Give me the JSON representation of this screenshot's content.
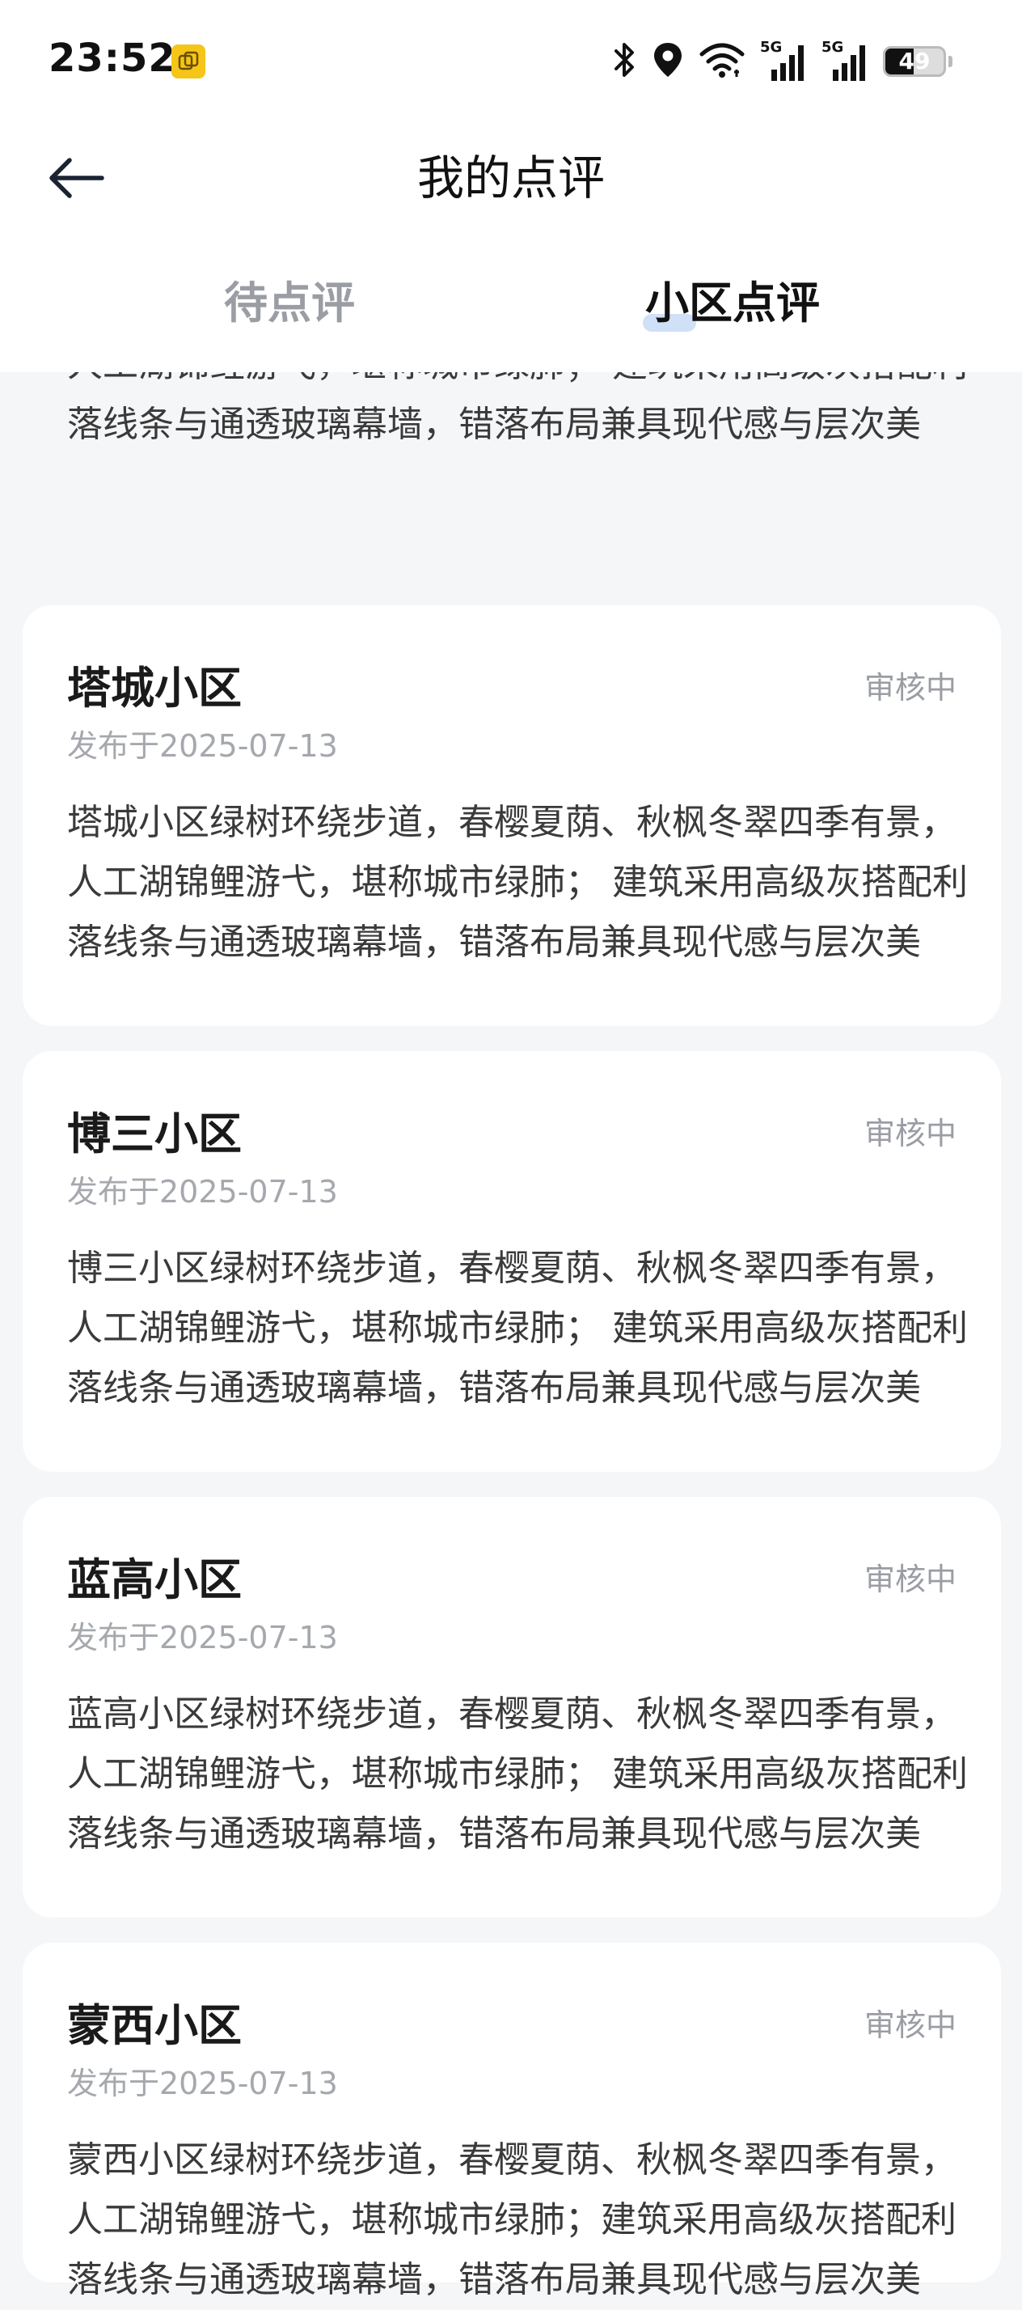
{
  "status_bar": {
    "time": "23:52",
    "signal_1_label": "5G",
    "signal_2_label": "5G",
    "battery_level": "49",
    "battery_fraction": 0.49
  },
  "header": {
    "title": "我的点评"
  },
  "tabs": [
    {
      "label": "待点评",
      "active": false
    },
    {
      "label": "小区点评",
      "active": true
    }
  ],
  "partial_review": {
    "text": "浦三小区绿树环绕步道，春樱夏荫、秋枫冬翠四季有景，人工湖锦鲤游弋，堪称城市绿肺； 建筑采用高级灰搭配利落线条与通透玻璃幕墙，错落布局兼具现代感与层次美"
  },
  "reviews": [
    {
      "name": "塔城小区",
      "status": "审核中",
      "date": "发布于2025-07-13",
      "text": "塔城小区绿树环绕步道，春樱夏荫、秋枫冬翠四季有景，人工湖锦鲤游弋，堪称城市绿肺； 建筑采用高级灰搭配利落线条与通透玻璃幕墙，错落布局兼具现代感与层次美"
    },
    {
      "name": "博三小区",
      "status": "审核中",
      "date": "发布于2025-07-13",
      "text": "博三小区绿树环绕步道，春樱夏荫、秋枫冬翠四季有景，人工湖锦鲤游弋，堪称城市绿肺； 建筑采用高级灰搭配利落线条与通透玻璃幕墙，错落布局兼具现代感与层次美"
    },
    {
      "name": "蓝高小区",
      "status": "审核中",
      "date": "发布于2025-07-13",
      "text": "蓝高小区绿树环绕步道，春樱夏荫、秋枫冬翠四季有景，人工湖锦鲤游弋，堪称城市绿肺； 建筑采用高级灰搭配利落线条与通透玻璃幕墙，错落布局兼具现代感与层次美"
    },
    {
      "name": "蒙西小区",
      "status": "审核中",
      "date": "发布于2025-07-13",
      "text": "蒙西小区绿树环绕步道，春樱夏荫、秋枫冬翠四季有景，人工湖锦鲤游弋，堪称城市绿肺；建筑采用高级灰搭配利落线条与通透玻璃幕墙，错落布局兼具现代感与层次美"
    }
  ],
  "colors": {
    "tab_indicator": "#cfe0f7",
    "status_text": "#9a9da3",
    "app_icon": "#f5c518"
  }
}
